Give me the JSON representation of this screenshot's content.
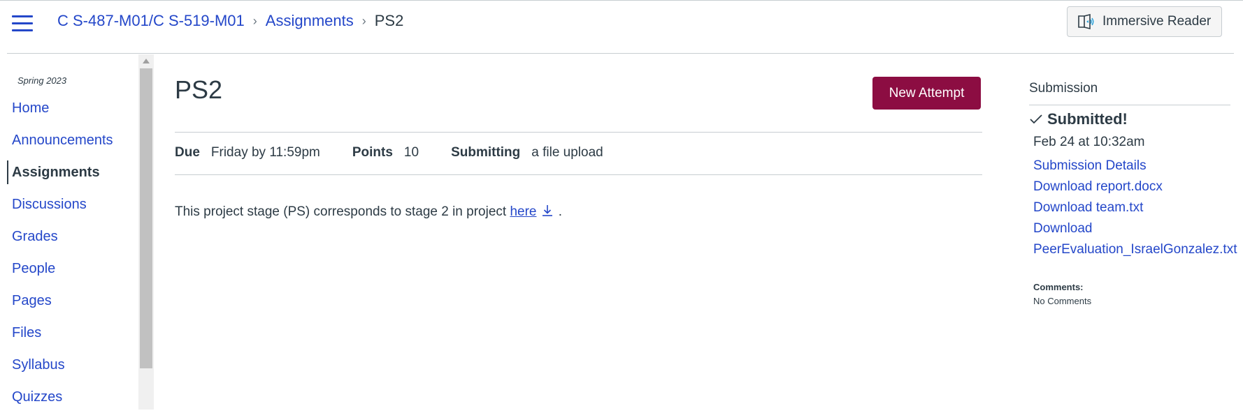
{
  "header": {
    "breadcrumb": {
      "course": "C S-487-M01/C S-519-M01",
      "section": "Assignments",
      "current": "PS2"
    },
    "immersive_reader_label": "Immersive Reader"
  },
  "sidebar": {
    "term": "Spring 2023",
    "items": [
      {
        "label": "Home"
      },
      {
        "label": "Announcements"
      },
      {
        "label": "Assignments"
      },
      {
        "label": "Discussions"
      },
      {
        "label": "Grades"
      },
      {
        "label": "People"
      },
      {
        "label": "Pages"
      },
      {
        "label": "Files"
      },
      {
        "label": "Syllabus"
      },
      {
        "label": "Quizzes"
      }
    ],
    "active_index": 2
  },
  "assignment": {
    "title": "PS2",
    "new_attempt_label": "New Attempt",
    "due_label": "Due",
    "due_value": "Friday by 11:59pm",
    "points_label": "Points",
    "points_value": "10",
    "submitting_label": "Submitting",
    "submitting_value": "a file upload",
    "description_before": "This project stage (PS) corresponds to stage 2 in project ",
    "description_link": "here",
    "description_after": " ."
  },
  "submission": {
    "title": "Submission",
    "status": "Submitted!",
    "date": "Feb 24 at 10:32am",
    "links": [
      "Submission Details",
      "Download report.docx",
      "Download team.txt",
      "Download",
      "PeerEvaluation_IsraelGonzalez.txt"
    ],
    "comments_label": "Comments:",
    "comments_value": "No Comments"
  },
  "colors": {
    "link": "#2447c9",
    "primary_button": "#8c0d42",
    "text": "#2d3b45"
  }
}
